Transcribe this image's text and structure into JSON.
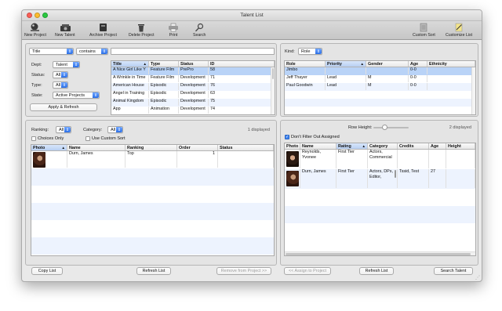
{
  "window": {
    "title": "Talent List"
  },
  "toolbar": {
    "new_project": "New Project",
    "new_talent": "New Talent",
    "archive_project": "Archive Project",
    "delete_project": "Delete Project",
    "print": "Print",
    "search": "Search",
    "custom_sort": "Custom Sort",
    "customize_list": "Customize List"
  },
  "project_filter": {
    "field": "Title",
    "operator": "contains",
    "search_value": "",
    "dept_label": "Dept:",
    "dept_value": "Talent",
    "status_label": "Status:",
    "status_value": "All",
    "type_label": "Type:",
    "type_value": "All",
    "state_label": "State:",
    "state_value": "Active Projects",
    "apply_button": "Apply & Refresh"
  },
  "projects_table": {
    "headers": [
      "Title",
      "Type",
      "Status",
      "ID"
    ],
    "rows": [
      [
        "A Nice Girl Like Y",
        "Feature Film",
        "PrePro",
        "58"
      ],
      [
        "A Wrinkle in Time",
        "Feature Film",
        "Development",
        "71"
      ],
      [
        "American House",
        "Episodic",
        "Development",
        "76"
      ],
      [
        "Angel in Training",
        "Episodic",
        "Development",
        "63"
      ],
      [
        "Animal Kingdom",
        "Episodic",
        "Development",
        "75"
      ],
      [
        "App",
        "Animation",
        "Development",
        "74"
      ]
    ]
  },
  "roles": {
    "kind_label": "Kind:",
    "kind_value": "Role",
    "headers": [
      "Role",
      "Priority",
      "Gender",
      "Age",
      "Ethnicity"
    ],
    "rows": [
      [
        "Jimbo",
        "",
        "",
        "0-0",
        ""
      ],
      [
        "Jeff Thayer",
        "Lead",
        "M",
        "0-0",
        ""
      ],
      [
        "Paul Goodwin",
        "Lead",
        "M",
        "0-0",
        ""
      ]
    ]
  },
  "ranking": {
    "ranking_label": "Ranking:",
    "ranking_value": "All",
    "category_label": "Category:",
    "category_value": "All",
    "displayed": "1 displayed",
    "choices_only": "Choices Only",
    "use_custom_sort": "Use Custom Sort",
    "headers": [
      "Photo",
      "Name",
      "Ranking",
      "Order",
      "Status"
    ],
    "rows": [
      [
        "",
        "Durn, James",
        "Top",
        "1",
        ""
      ]
    ],
    "copy_list": "Copy List",
    "refresh_list": "Refresh List",
    "remove_from_project": "Remove from Project >>"
  },
  "talent": {
    "row_height_label": "Row Height:",
    "row_height_fraction": 0.3,
    "displayed": "2 displayed",
    "dont_filter": "Don't Filter Out Assigned",
    "headers": [
      "Photo",
      "Name",
      "Rating",
      "Category",
      "Credits",
      "Age",
      "Height"
    ],
    "rows": [
      [
        "",
        "Reynolds, Yvonee",
        "First Tier",
        "Actors, Commercial",
        "",
        "",
        ""
      ],
      [
        "",
        "Durn, James",
        "First Tier",
        "Actors, DPs, Editor,",
        "Tssid, Test",
        "27",
        ""
      ]
    ],
    "assign_to_project": "<< Assign to Project",
    "refresh_list": "Refresh List",
    "search_talent": "Search Talent"
  },
  "colors": {
    "accent": "#3b7cf0",
    "selection": "#b9d3f7",
    "alt_row": "#edf3fe"
  }
}
